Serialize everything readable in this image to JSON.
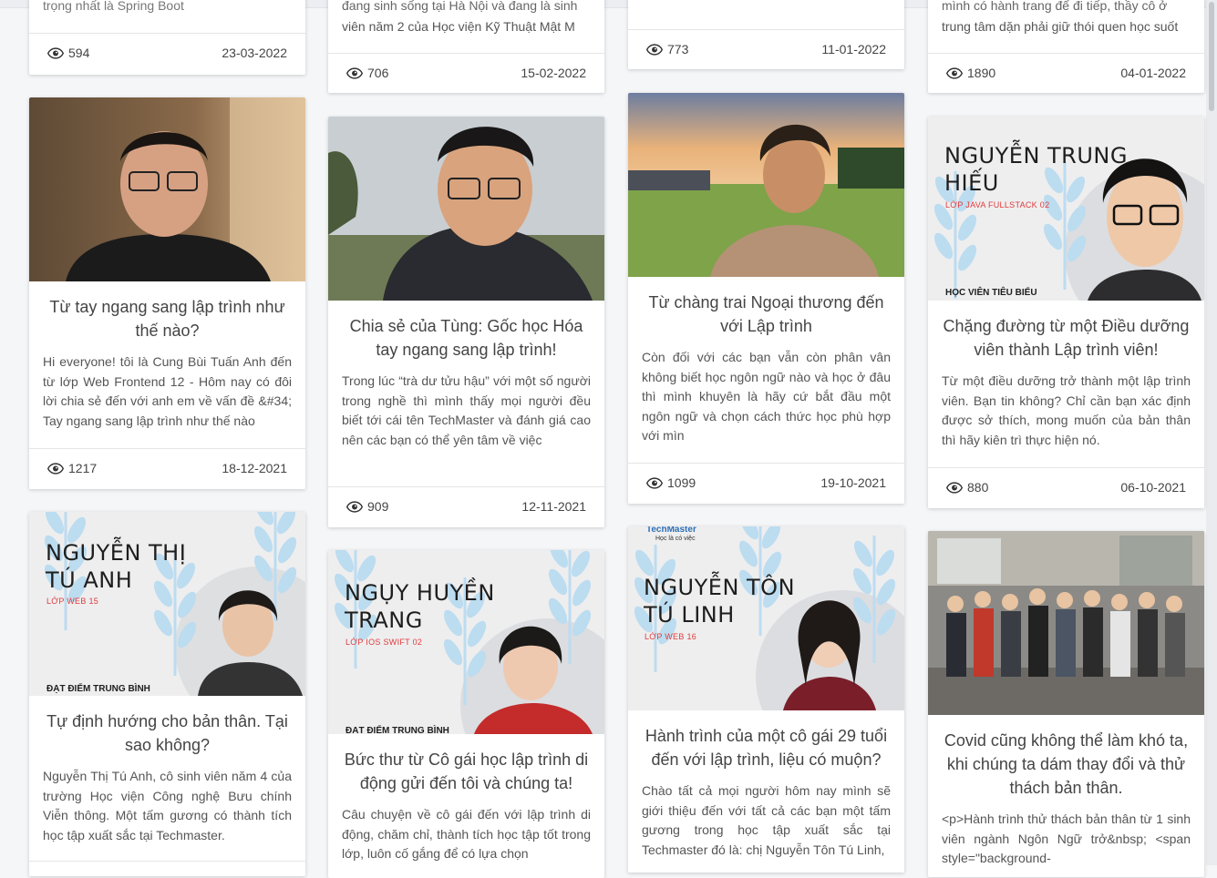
{
  "cards": [
    {
      "id": "c1",
      "excerpt_tail": "trọng nhất là Spring Boot",
      "views": "594",
      "date": "23-03-2022"
    },
    {
      "id": "c2",
      "excerpt_tail1": "đang sinh sống tại Hà Nội và đang là sinh",
      "excerpt_tail2": "viên năm 2 của Học viện Kỹ Thuật Mật M",
      "views": "706",
      "date": "15-02-2022"
    },
    {
      "id": "c3",
      "views": "773",
      "date": "11-01-2022"
    },
    {
      "id": "c4",
      "excerpt_tail1": "mình có hành trang để đi tiếp, thầy cô ở",
      "excerpt_tail2": "trung tâm dặn phải giữ thói quen học suốt",
      "views": "1890",
      "date": "04-01-2022"
    },
    {
      "id": "c5",
      "title": "Từ tay ngang sang lập trình như thế nào?",
      "excerpt": "Hi everyone! tôi là Cung Bùi Tuấn Anh đến từ lớp Web Frontend 12 -  Hôm nay có đôi lời chia sẻ đến với anh em về vấn đề &#34; Tay ngang sang lập trình như thế nào",
      "views": "1217",
      "date": "18-12-2021"
    },
    {
      "id": "c6",
      "title": "Chia sẻ của Tùng: Gốc học Hóa tay ngang sang lập trình!",
      "excerpt": "Trong lúc “trà dư tửu hậu” với một số người trong nghề thì mình thấy mọi người đều biết tới cái tên TechMaster và đánh giá cao nên các bạn có thể yên tâm về việc",
      "views": "909",
      "date": "12-11-2021"
    },
    {
      "id": "c7",
      "title": "Từ chàng trai Ngoại thương đến với Lập trình",
      "excerpt": "Còn đối với các bạn vẫn còn phân vân không biết học ngôn ngữ nào và học ở đâu thì mình khuyên là hãy cứ bắt đầu một ngôn ngữ và chọn cách thức học phù hợp với mìn",
      "views": "1099",
      "date": "19-10-2021"
    },
    {
      "id": "c8",
      "title": "Chặng đường từ một Điều dưỡng viên thành Lập trình viên!",
      "excerpt": "Từ một điều dưỡng trở thành một lập trình viên. Bạn tin không? Chỉ cần bạn xác định được sở thích, mong muốn của bản thân thì hãy kiên trì thực hiện nó.",
      "views": "880",
      "date": "06-10-2021",
      "banner": {
        "name1": "NGUYỄN TRUNG",
        "name2": "HIẾU",
        "class": "LỚP JAVA FULLSTACK 02",
        "tag": "HỌC VIÊN TIÊU BIỂU"
      }
    },
    {
      "id": "c9",
      "title": "Tự định hướng cho bản thân. Tại sao không?",
      "excerpt": "Nguyễn Thị Tú Anh, cô sinh viên năm 4 của trường Học viện Công nghệ Bưu chính Viễn thông. Một tấm gương có thành tích học tập xuất sắc tại Techmaster.",
      "banner": {
        "name1": "NGUYỄN THỊ",
        "name2": "TÚ ANH",
        "class": "LỚP WEB 15",
        "tag": "ĐẠT ĐIỂM TRUNG BÌNH"
      }
    },
    {
      "id": "c10",
      "title": "Bức thư từ Cô gái học lập trình di động gửi đến tôi và chúng ta!",
      "excerpt": "Câu chuyện về cô gái đến với lập trình di động, chăm chỉ, thành tích học tập tốt trong lớp, luôn cố gắng để có lựa chọn",
      "banner": {
        "name1": "NGỤY HUYỀN",
        "name2": "TRANG",
        "class": "LỚP IOS SWIFT 02",
        "tag": "ĐẠT ĐIỂM TRUNG BÌNH"
      }
    },
    {
      "id": "c11",
      "title": "Hành trình của một cô gái 29 tuổi đến với lập trình, liệu có muộn?",
      "excerpt": "Chào tất cả mọi người hôm nay mình sẽ giới thiệu đến với tất cả các bạn một tấm gương trong học tập xuất sắc tại Techmaster đó là: chị Nguyễn Tôn Tú Linh,",
      "banner": {
        "logo": "TechMaster",
        "slogan": "Học là có việc",
        "name1": "NGUYỄN TÔN",
        "name2": "TÚ LINH",
        "class": "LỚP WEB 16"
      }
    },
    {
      "id": "c12",
      "title": "Covid cũng không thể làm khó ta, khi chúng ta dám thay đổi và thử thách bản thân.",
      "excerpt": "<p>Hành trình thử thách bản thân từ 1 sinh viên ngành Ngôn Ngữ trở&nbsp; <span style=\"background-"
    }
  ],
  "colors": {
    "accent": "#e13b3b",
    "background": "#f5f6f8",
    "card": "#ffffff",
    "leaf": "#bcdcf0"
  },
  "icons": {
    "views": "eye-icon"
  }
}
